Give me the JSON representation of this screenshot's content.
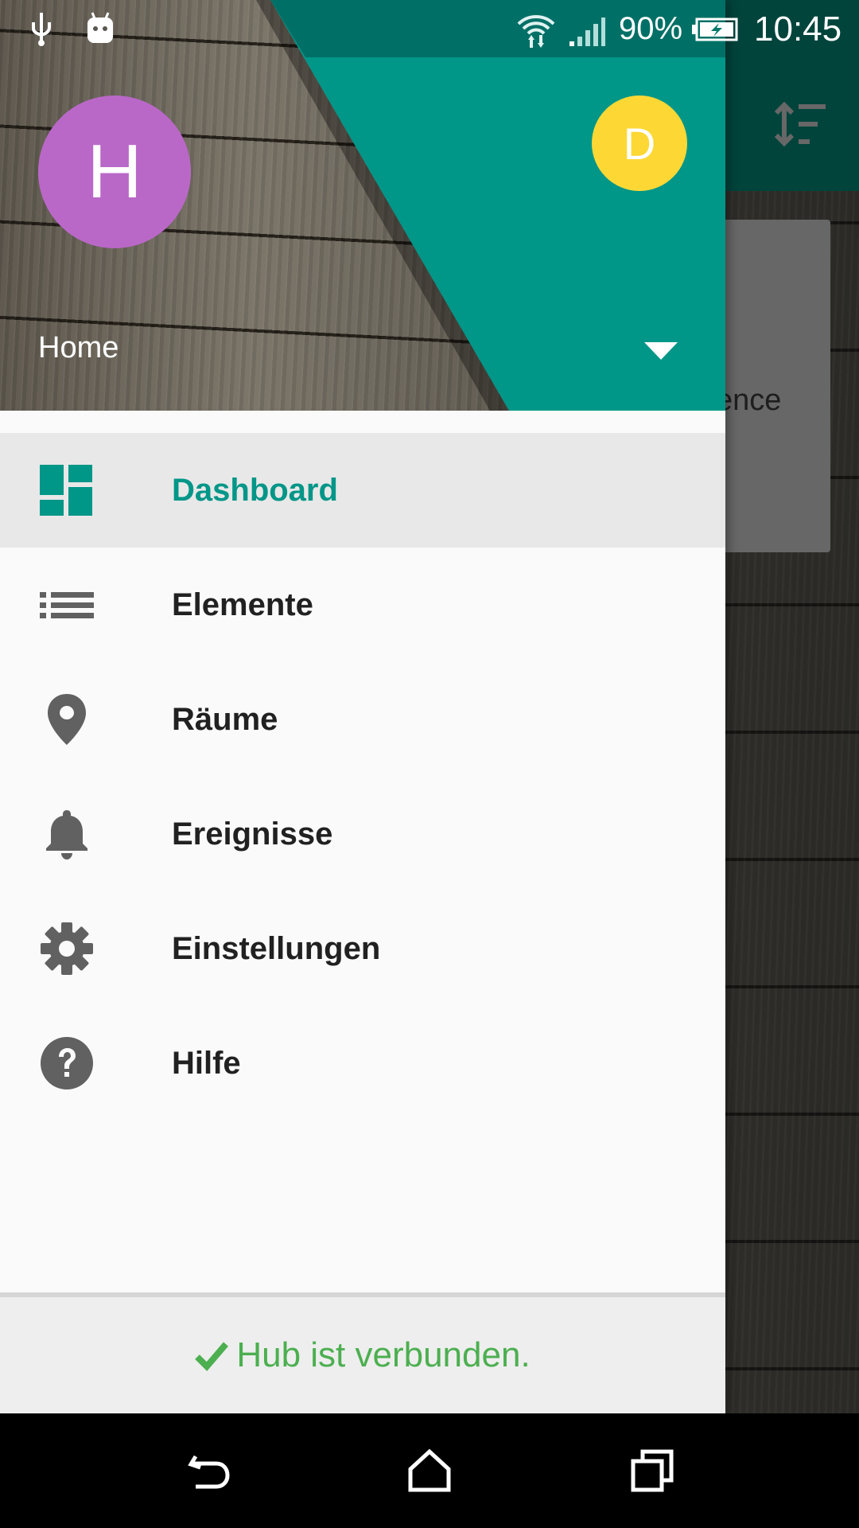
{
  "status_bar": {
    "battery_percent": "90%",
    "time": "10:45",
    "icons": [
      "usb-icon",
      "android-debug-icon",
      "wifi-icon",
      "cell-signal-icon",
      "battery-charging-icon"
    ]
  },
  "background_app": {
    "card_text": "ence",
    "toolbar_icon": "sort-icon"
  },
  "drawer": {
    "account": {
      "avatar_letter": "H",
      "avatar_color": "#ba68c8",
      "secondary_avatar_letter": "D",
      "secondary_avatar_color": "#fdd835",
      "name": "Home"
    },
    "items": [
      {
        "label": "Dashboard",
        "icon": "dashboard-icon",
        "active": true
      },
      {
        "label": "Elemente",
        "icon": "list-icon",
        "active": false
      },
      {
        "label": "Räume",
        "icon": "location-pin-icon",
        "active": false
      },
      {
        "label": "Ereignisse",
        "icon": "bell-icon",
        "active": false
      },
      {
        "label": "Einstellungen",
        "icon": "gear-icon",
        "active": false
      },
      {
        "label": "Hilfe",
        "icon": "help-icon",
        "active": false
      }
    ],
    "footer_status": "Hub ist verbunden."
  },
  "colors": {
    "accent": "#009688",
    "status_ok": "#4caf50"
  },
  "navigation_bar": [
    "back-icon",
    "home-icon",
    "recents-icon"
  ]
}
